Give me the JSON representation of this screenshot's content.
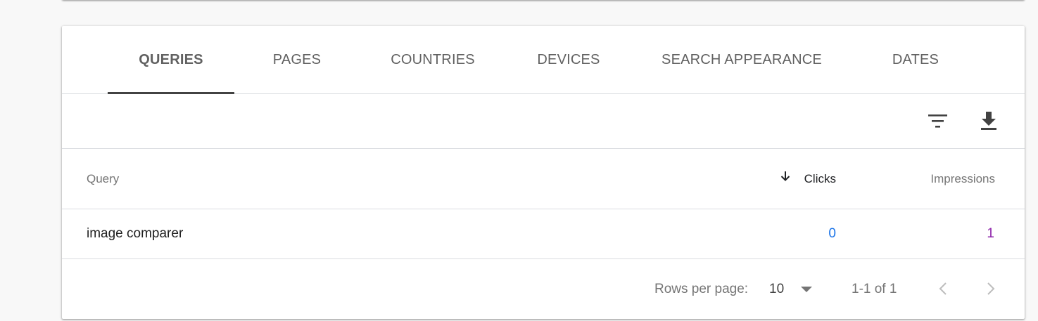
{
  "tabs": [
    {
      "label": "QUERIES",
      "active": true
    },
    {
      "label": "PAGES"
    },
    {
      "label": "COUNTRIES"
    },
    {
      "label": "DEVICES"
    },
    {
      "label": "SEARCH APPEARANCE"
    },
    {
      "label": "DATES"
    }
  ],
  "toolbar": {
    "filter_icon": "filter-icon",
    "download_icon": "download-icon"
  },
  "table": {
    "columns": {
      "query": "Query",
      "clicks": "Clicks",
      "impressions": "Impressions"
    },
    "sort": {
      "column": "Clicks",
      "direction": "descending",
      "icon": "arrow-down-icon"
    },
    "rows": [
      {
        "query": "image comparer",
        "clicks": "0",
        "impressions": "1"
      }
    ]
  },
  "pagination": {
    "rows_per_page_label": "Rows per page:",
    "rows_per_page_value": "10",
    "range": "1-1 of 1",
    "prev_icon": "chevron-left-icon",
    "next_icon": "chevron-right-icon"
  },
  "colors": {
    "clicks": "#1a73e8",
    "impressions": "#8e24aa",
    "tab_indicator": "#424242"
  }
}
